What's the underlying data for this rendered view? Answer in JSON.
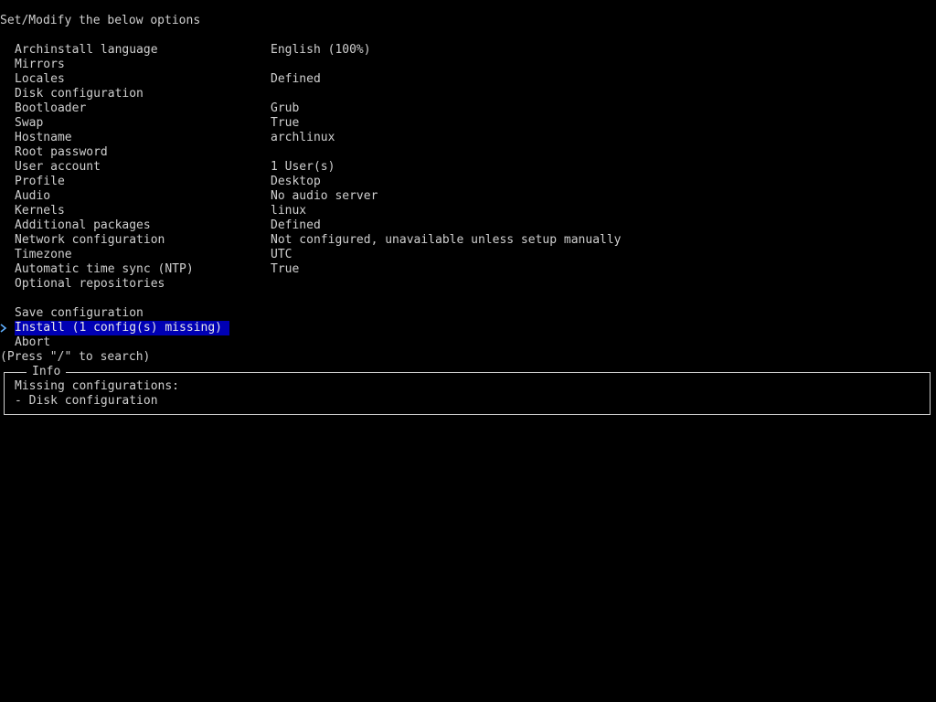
{
  "header": {
    "title": "Set/Modify the below options"
  },
  "options": [
    {
      "label": "Archinstall language",
      "value": "English (100%)"
    },
    {
      "label": "Mirrors",
      "value": ""
    },
    {
      "label": "Locales",
      "value": "Defined"
    },
    {
      "label": "Disk configuration",
      "value": ""
    },
    {
      "label": "Bootloader",
      "value": "Grub"
    },
    {
      "label": "Swap",
      "value": "True"
    },
    {
      "label": "Hostname",
      "value": "archlinux"
    },
    {
      "label": "Root password",
      "value": ""
    },
    {
      "label": "User account",
      "value": "1 User(s)"
    },
    {
      "label": "Profile",
      "value": "Desktop"
    },
    {
      "label": "Audio",
      "value": "No audio server"
    },
    {
      "label": "Kernels",
      "value": "linux"
    },
    {
      "label": "Additional packages",
      "value": "Defined"
    },
    {
      "label": "Network configuration",
      "value": "Not configured, unavailable unless setup manually"
    },
    {
      "label": "Timezone",
      "value": "UTC"
    },
    {
      "label": "Automatic time sync (NTP)",
      "value": "True"
    },
    {
      "label": "Optional repositories",
      "value": ""
    }
  ],
  "actions": {
    "save": "Save configuration",
    "install": "Install (1 config(s) missing)",
    "abort": "Abort"
  },
  "cursor_icon": "chevron-right-icon",
  "search_hint": "(Press \"/\" to search)",
  "info": {
    "title": "Info",
    "lines": [
      "Missing configurations:",
      "- Disk configuration"
    ]
  },
  "colors": {
    "background": "#000000",
    "text": "#cfcfcf",
    "selection_bg": "#0000b4",
    "cursor": "#5fafff"
  }
}
